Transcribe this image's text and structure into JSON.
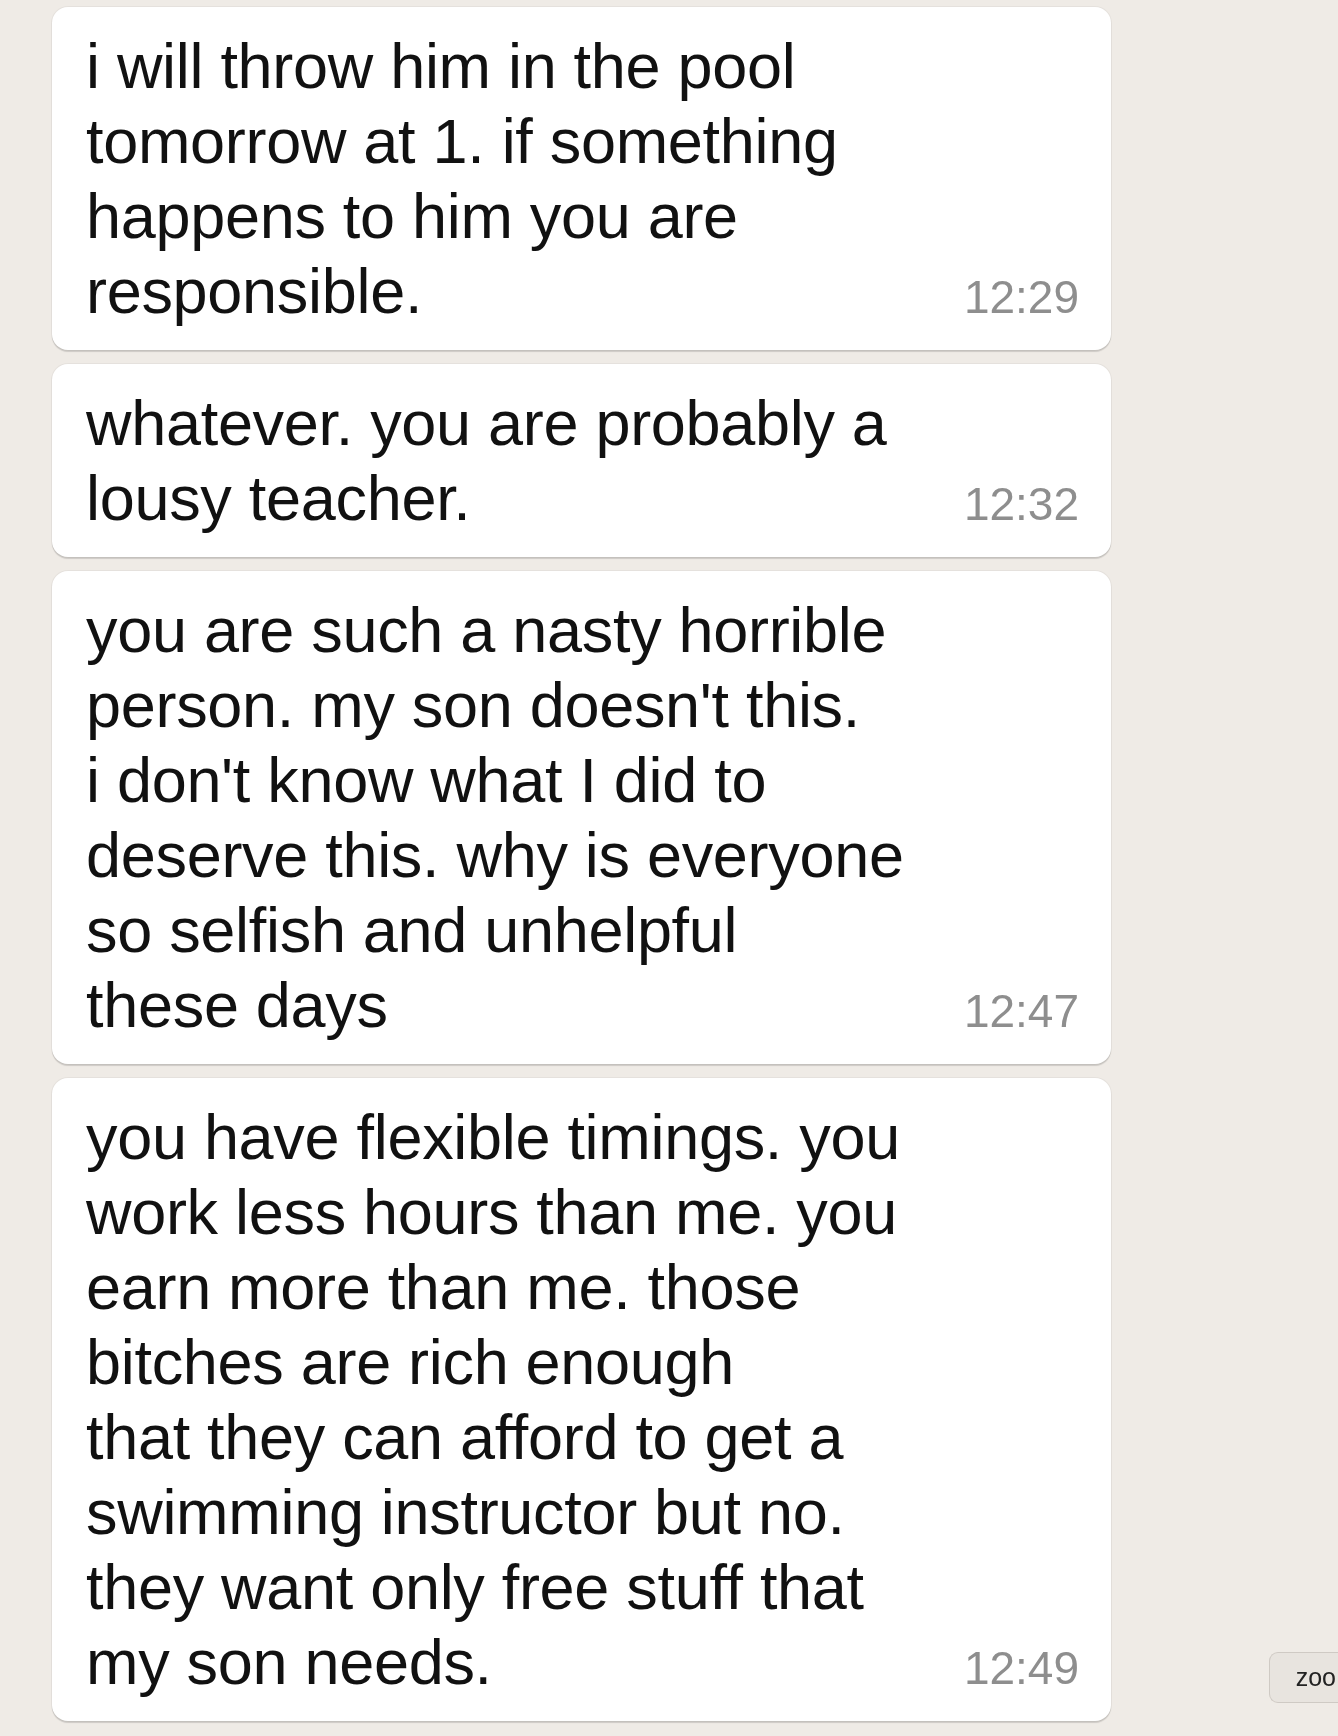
{
  "messages": [
    {
      "text": "i will throw him in the pool\ntomorrow at 1. if something\nhappens to him you are\nresponsible.",
      "time": "12:29"
    },
    {
      "text": "whatever. you are probably a\nlousy teacher.",
      "time": "12:32"
    },
    {
      "text": "you are such a nasty horrible\nperson. my son doesn't this.\ni don't know what I did to\ndeserve this. why is everyone\nso selfish and unhelpful\nthese days",
      "time": "12:47"
    },
    {
      "text": "you have flexible timings. you\nwork less hours than me. you\nearn more than me. those\nbitches are rich enough\nthat they can afford to get a\nswimming instructor but no.\nthey want only free stuff that\nmy son needs.",
      "time": "12:49"
    }
  ],
  "zoom_button": {
    "label": "zoo"
  }
}
